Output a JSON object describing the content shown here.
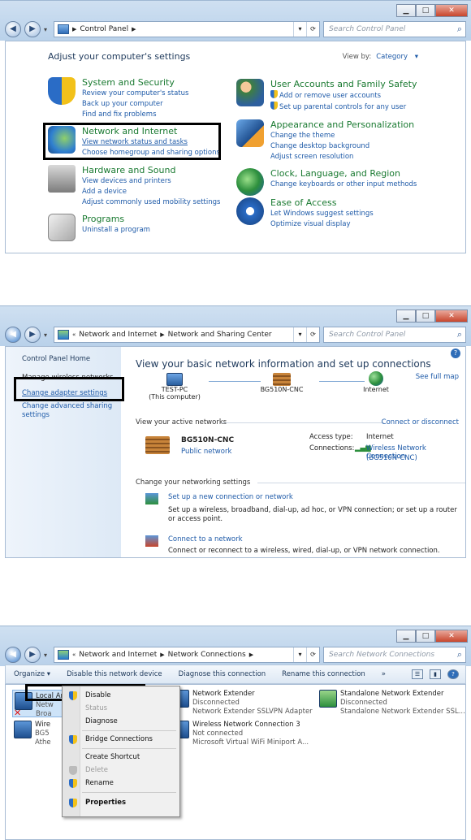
{
  "screen1": {
    "address": {
      "crumbs": [
        "Control Panel"
      ]
    },
    "search_placeholder": "Search Control Panel",
    "title": "Adjust your computer's settings",
    "view_by": {
      "label": "View by:",
      "value": "Category"
    },
    "categories": [
      {
        "name": "System and Security",
        "icon": "shield-icon",
        "links": [
          "Review your computer's status",
          "Back up your computer",
          "Find and fix problems"
        ]
      },
      {
        "name": "Network and Internet",
        "icon": "network-globe-icon",
        "links": [
          "View network status and tasks",
          "Choose homegroup and sharing options"
        ]
      },
      {
        "name": "Hardware and Sound",
        "icon": "printer-icon",
        "links": [
          "View devices and printers",
          "Add a device",
          "Adjust commonly used mobility settings"
        ]
      },
      {
        "name": "Programs",
        "icon": "programs-icon",
        "links": [
          "Uninstall a program"
        ]
      },
      {
        "name": "User Accounts and Family Safety",
        "icon": "users-icon",
        "links": [
          "Add or remove user accounts",
          "Set up parental controls for any user"
        ]
      },
      {
        "name": "Appearance and Personalization",
        "icon": "monitor-brush-icon",
        "links": [
          "Change the theme",
          "Change desktop background",
          "Adjust screen resolution"
        ]
      },
      {
        "name": "Clock, Language, and Region",
        "icon": "clock-globe-icon",
        "links": [
          "Change keyboards or other input methods"
        ]
      },
      {
        "name": "Ease of Access",
        "icon": "ease-of-access-icon",
        "links": [
          "Let Windows suggest settings",
          "Optimize visual display"
        ]
      }
    ]
  },
  "screen2": {
    "address": {
      "crumbs": [
        "Network and Internet",
        "Network and Sharing Center"
      ]
    },
    "search_placeholder": "Search Control Panel",
    "left_pane": [
      "Control Panel Home",
      "Manage wireless networks",
      "Change adapter settings",
      "Change advanced sharing settings"
    ],
    "title": "View your basic network information and set up connections",
    "see_full_map": "See full map",
    "nodes": [
      {
        "name": "TEST-PC",
        "sub": "(This computer)"
      },
      {
        "name": "BG510N-CNC",
        "sub": ""
      },
      {
        "name": "Internet",
        "sub": ""
      }
    ],
    "active_networks_label": "View your active networks",
    "connect_disconnect": "Connect or disconnect",
    "network": {
      "name": "BG510N-CNC",
      "type": "Public network"
    },
    "access_type_label": "Access type:",
    "access_type_value": "Internet",
    "connections_label": "Connections:",
    "connections_value": "Wireless Network Connection",
    "connections_value2": "(BG510N-CNC)",
    "change_settings_label": "Change your networking settings",
    "tasks": [
      {
        "title": "Set up a new connection or network",
        "desc": "Set up a wireless, broadband, dial-up, ad hoc, or VPN connection; or set up a router or access point."
      },
      {
        "title": "Connect to a network",
        "desc": "Connect or reconnect to a wireless, wired, dial-up, or VPN network connection."
      }
    ]
  },
  "screen3": {
    "address": {
      "crumbs": [
        "Network and Internet",
        "Network Connections"
      ]
    },
    "search_placeholder": "Search Network Connections",
    "toolbar": [
      "Organize ▾",
      "Disable this network device",
      "Diagnose this connection",
      "Rename this connection",
      "»"
    ],
    "connections": [
      {
        "name": "Local Area Connection",
        "status": "Netw",
        "device": "Broa"
      },
      {
        "name": "Wire",
        "status": "BG5",
        "device": "Athe"
      },
      {
        "name": "Network Extender",
        "status": "Disconnected",
        "device": "Network Extender SSLVPN Adapter"
      },
      {
        "name": "Wireless Network Connection 3",
        "status": "Not connected",
        "device": "Microsoft Virtual WiFi Miniport A..."
      },
      {
        "name": "Standalone Network Extender",
        "status": "Disconnected",
        "device": "Standalone Network Extender SSL..."
      }
    ],
    "context_menu": [
      {
        "label": "Disable",
        "disabled": false
      },
      {
        "label": "Status",
        "disabled": true
      },
      {
        "label": "Diagnose",
        "disabled": false
      },
      {
        "label": "Bridge Connections",
        "disabled": false
      },
      {
        "label": "Create Shortcut",
        "disabled": false
      },
      {
        "label": "Delete",
        "disabled": true
      },
      {
        "label": "Rename",
        "disabled": false
      },
      {
        "label": "Properties",
        "disabled": false
      }
    ]
  }
}
